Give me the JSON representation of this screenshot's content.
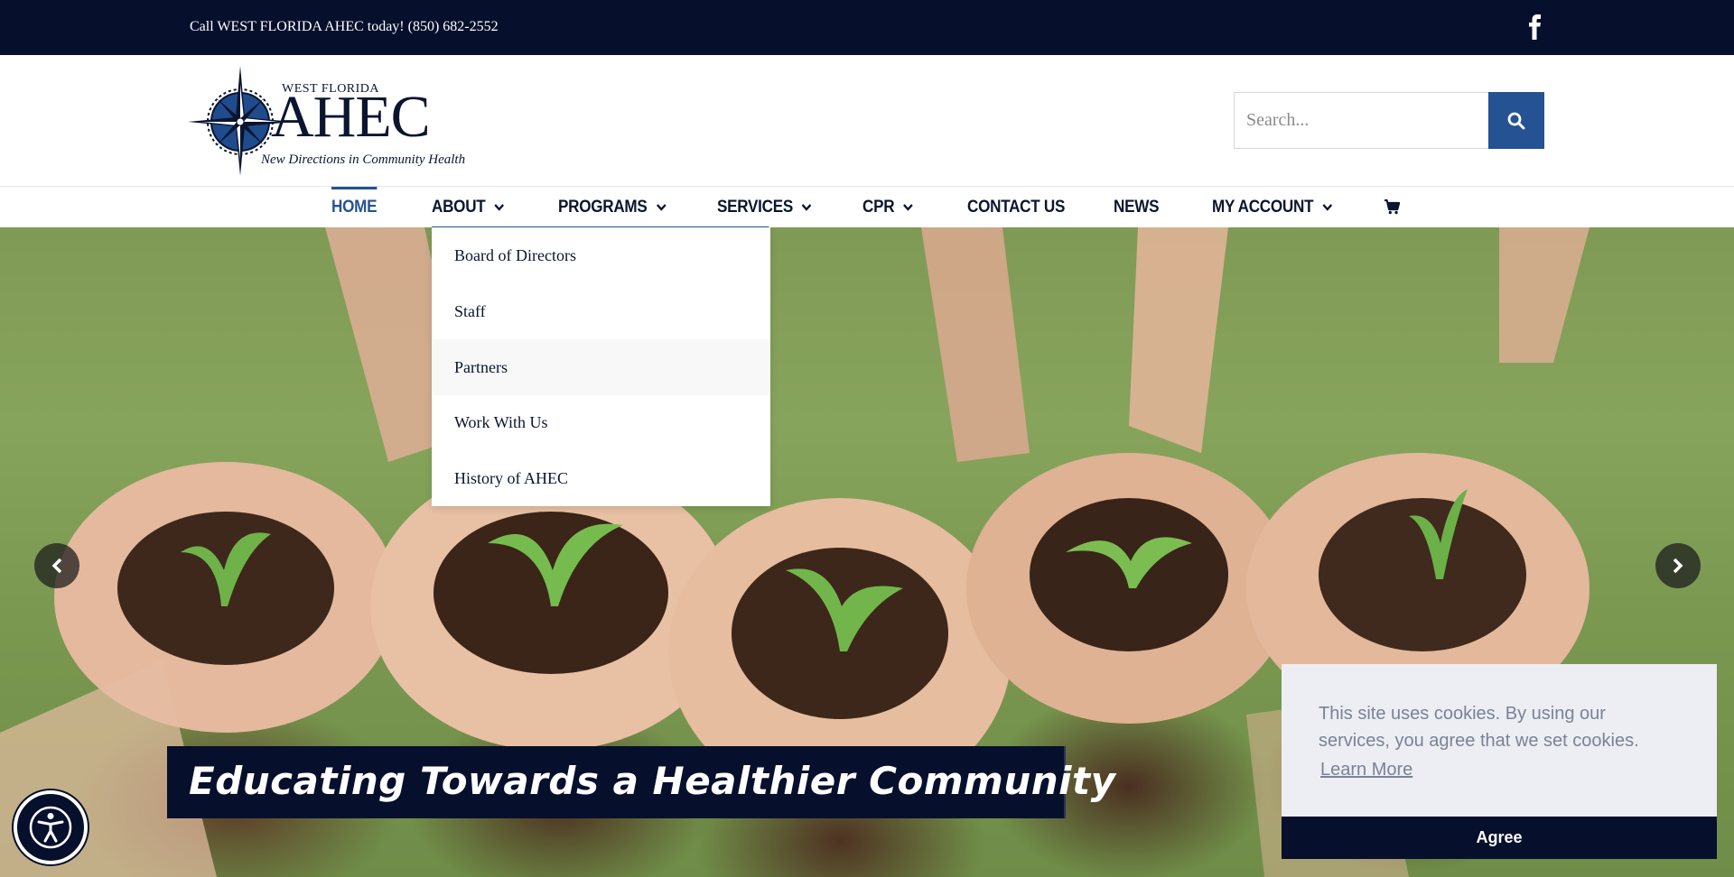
{
  "topbar": {
    "call_text": "Call WEST FLORIDA AHEC today! (850) 682-2552",
    "social_icon": "facebook-icon"
  },
  "logo": {
    "line1": "WEST FLORIDA",
    "line2": "AHEC",
    "tagline": "New Directions in Community Health"
  },
  "search": {
    "placeholder": "Search...",
    "button_icon": "search-icon"
  },
  "nav": {
    "items": [
      {
        "label": "HOME",
        "active": true,
        "has_dropdown": false
      },
      {
        "label": "ABOUT",
        "has_dropdown": true,
        "open": true
      },
      {
        "label": "PROGRAMS",
        "has_dropdown": true
      },
      {
        "label": "SERVICES",
        "has_dropdown": true
      },
      {
        "label": "CPR",
        "has_dropdown": true
      },
      {
        "label": "CONTACT US",
        "has_dropdown": false
      },
      {
        "label": "NEWS",
        "has_dropdown": false
      },
      {
        "label": "MY ACCOUNT",
        "has_dropdown": true
      }
    ],
    "cart_icon": "cart-icon"
  },
  "about_dropdown": {
    "items": [
      "Board of Directors",
      "Staff",
      "Partners",
      "Work With Us",
      "History of AHEC"
    ],
    "hovered": "Partners"
  },
  "hero": {
    "tagline": "Educating Towards a Healthier Community",
    "prev_icon": "chevron-left-icon",
    "next_icon": "chevron-right-icon"
  },
  "cookie": {
    "message": "This site uses cookies. By using our services, you agree that we set cookies.",
    "learn_more": "Learn More",
    "agree": "Agree"
  },
  "accessibility": {
    "icon": "accessibility-icon"
  },
  "colors": {
    "navy": "#060f2c",
    "accent_blue": "#245293",
    "cookie_bg": "#eceef3",
    "cookie_text": "#7b8296"
  }
}
